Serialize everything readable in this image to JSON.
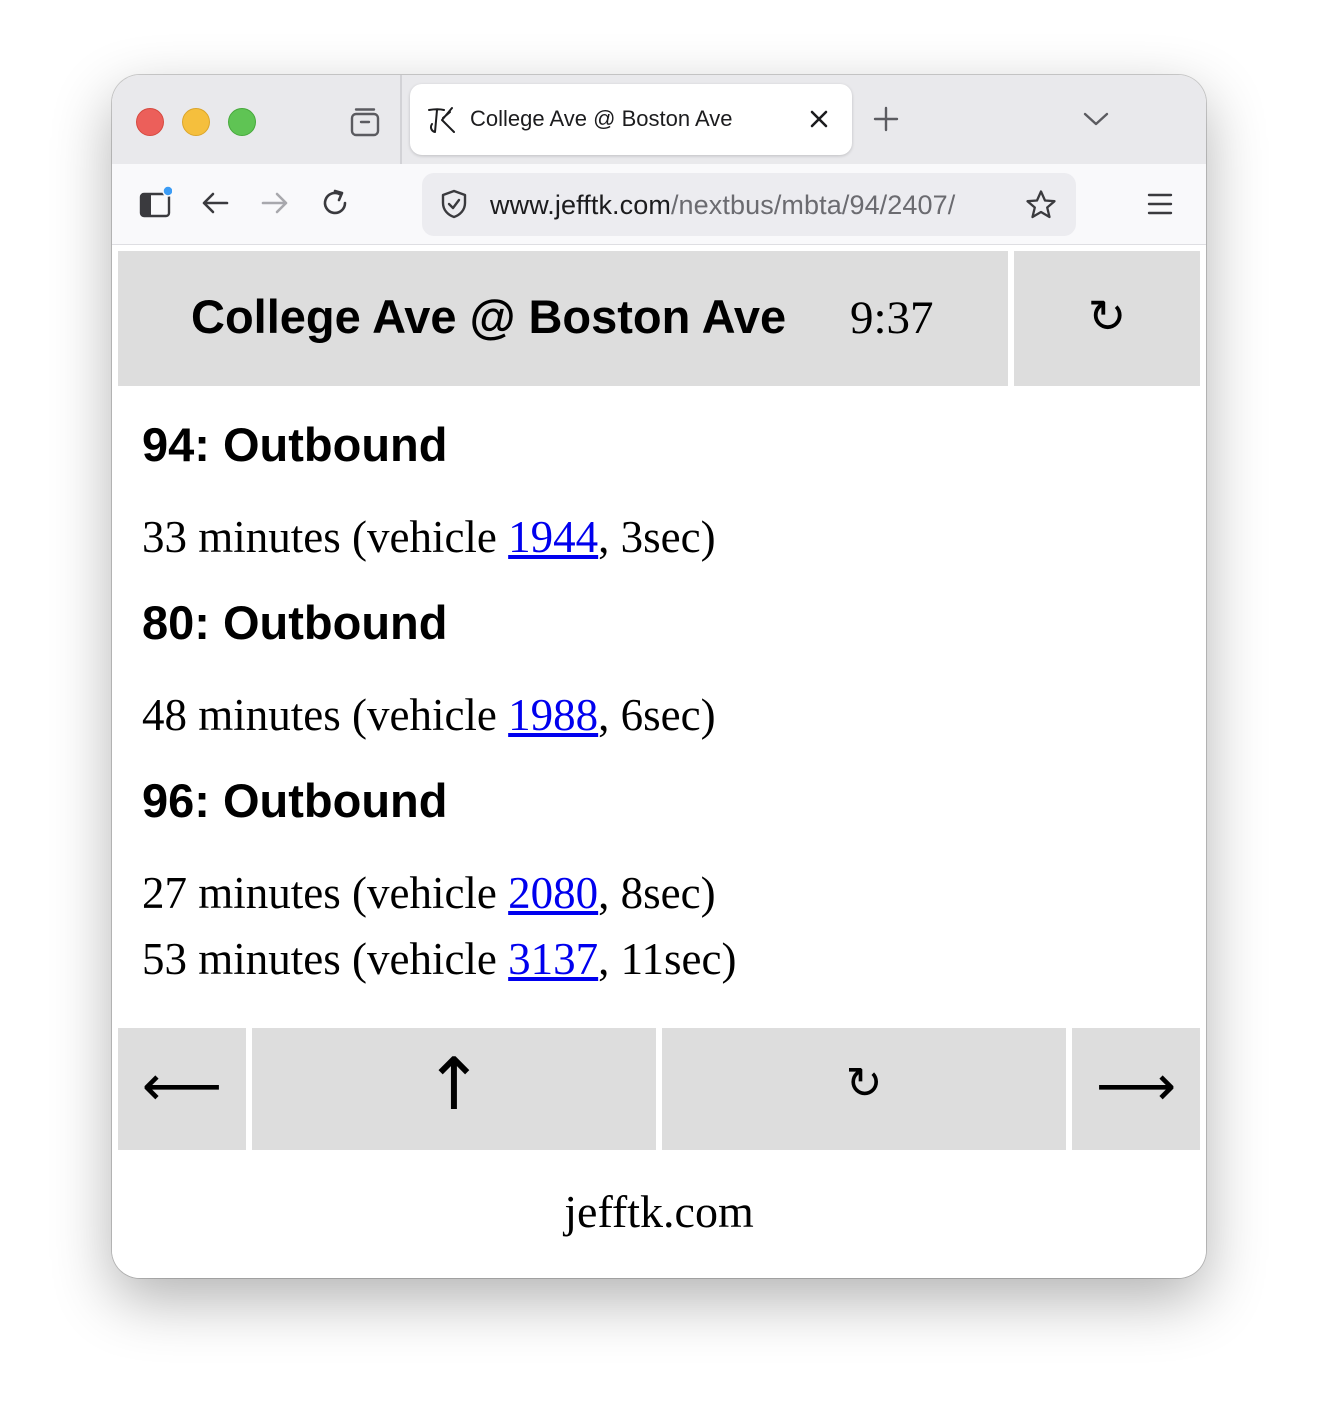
{
  "browser": {
    "tab_title": "College Ave @ Boston Ave",
    "url_host": "www.jefftk.com",
    "url_path": "/nextbus/mbta/94/2407/"
  },
  "header": {
    "stop_name": "College Ave @ Boston Ave",
    "time": "9:37",
    "refresh_glyph": "↻"
  },
  "routes": [
    {
      "heading": "94: Outbound",
      "predictions": [
        {
          "minutes_text": "33 minutes (vehicle ",
          "vehicle": "1944",
          "age_text": ", 3sec)"
        }
      ]
    },
    {
      "heading": "80: Outbound",
      "predictions": [
        {
          "minutes_text": "48 minutes (vehicle ",
          "vehicle": "1988",
          "age_text": ", 6sec)"
        }
      ]
    },
    {
      "heading": "96: Outbound",
      "predictions": [
        {
          "minutes_text": "27 minutes (vehicle ",
          "vehicle": "2080",
          "age_text": ", 8sec)"
        },
        {
          "minutes_text": "53 minutes (vehicle ",
          "vehicle": "3137",
          "age_text": ", 11sec)"
        }
      ]
    }
  ],
  "nav": {
    "prev_glyph": "⟵",
    "up_glyph": "↑",
    "refresh_glyph": "↻",
    "next_glyph": "⟶"
  },
  "footer": {
    "site": "jefftk.com"
  },
  "colors": {
    "button_bg": "#dddddd",
    "link": "#0000ee"
  }
}
